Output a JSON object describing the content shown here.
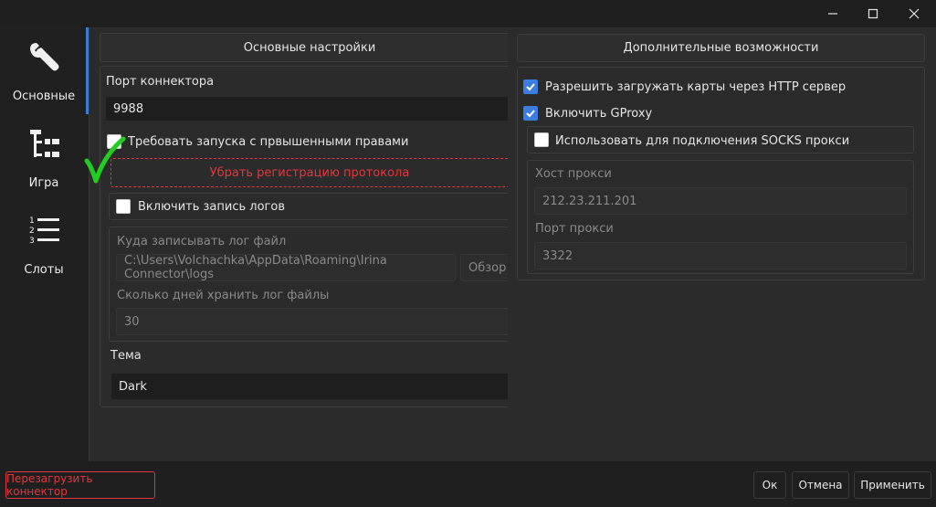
{
  "window": {
    "minimize_glyph": "—",
    "maximize_glyph": "☐",
    "close_glyph": "✕"
  },
  "nav": [
    {
      "label": "Основные",
      "icon": "wrench-icon"
    },
    {
      "label": "Игра",
      "icon": "tree-list-icon"
    },
    {
      "label": "Слоты",
      "icon": "numbered-list-icon"
    }
  ],
  "main": {
    "header": "Основные настройки",
    "port_label": "Порт коннектора",
    "port_value": "9988",
    "require_admin_label": "Требовать запуска с првышенными правами",
    "require_admin_checked": false,
    "unregister_protocol_label": "Убрать регистрацию протокола",
    "enable_logs_label": "Включить запись логов",
    "enable_logs_checked": false,
    "log_path_label": "Куда записывать лог файл",
    "log_path_value": "C:\\Users\\Volchachka\\AppData\\Roaming\\Irina Connector\\logs",
    "browse_label": "Обзор",
    "log_days_label": "Сколько дней хранить лог файлы",
    "log_days_value": "30",
    "theme_label": "Тема",
    "theme_value": "Dark"
  },
  "extra": {
    "header": "Дополнительные возможности",
    "allow_http_label": "Разрешить загружать карты через HTTP сервер",
    "allow_http_checked": true,
    "gproxy_label": "Включить GProxy",
    "gproxy_checked": true,
    "socks_label": "Использовать для подключения SOCKS прокси",
    "socks_checked": false,
    "proxy_host_label": "Хост прокси",
    "proxy_host_value": "212.23.211.201",
    "proxy_port_label": "Порт прокси",
    "proxy_port_value": "3322"
  },
  "footer": {
    "restart_label": "Перезагрузить коннектор",
    "ok_label": "Ок",
    "cancel_label": "Отмена",
    "apply_label": "Применить"
  },
  "colors": {
    "accent": "#3b7de0",
    "danger": "#e0383e",
    "checkmark_overlay": "#22cc22"
  }
}
